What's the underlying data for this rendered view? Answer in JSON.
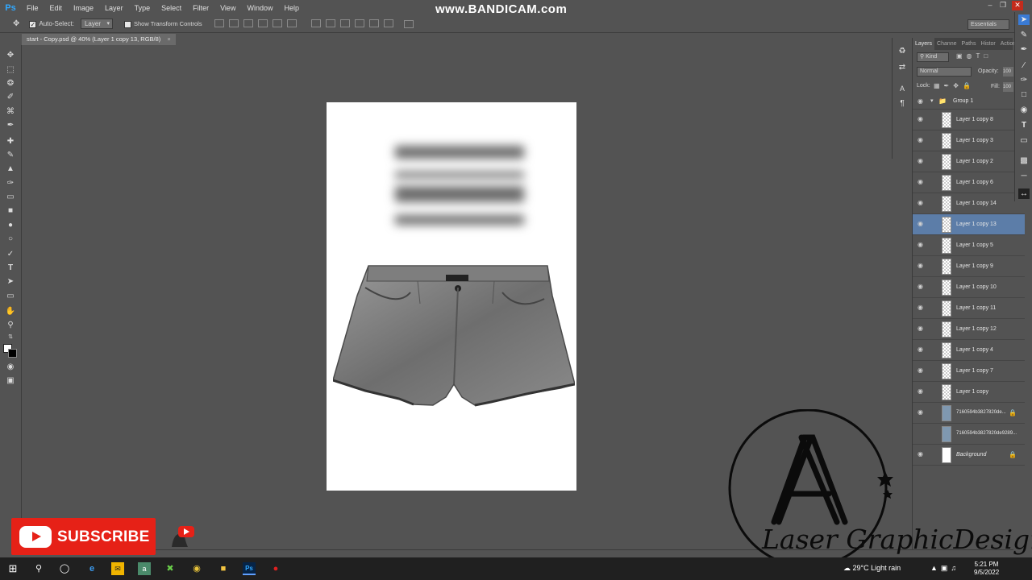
{
  "app": {
    "logo": "Ps",
    "menu": [
      "File",
      "Edit",
      "Image",
      "Layer",
      "Type",
      "Select",
      "Filter",
      "View",
      "Window",
      "Help"
    ],
    "watermark": "www.BANDICAM.com"
  },
  "options_bar": {
    "auto_select_label": "Auto-Select:",
    "auto_select_value": "Layer",
    "transform_label": "Show Transform Controls",
    "workspace": "Essentials"
  },
  "document": {
    "tab_title": "start - Copy.psd @ 40% (Layer 1 copy 13, RGB/8)"
  },
  "layers_panel": {
    "tabs": [
      "Layers",
      "Channe",
      "Paths",
      "Histor",
      "Action"
    ],
    "filter_kind": "Kind",
    "blend_mode": "Normal",
    "opacity_label": "Opacity:",
    "opacity_value": "100",
    "lock_label": "Lock:",
    "fill_label": "Fill:",
    "fill_value": "100",
    "group_name": "Group 1",
    "layers": [
      {
        "name": "Layer 1 copy 8",
        "selected": false
      },
      {
        "name": "Layer 1 copy 3",
        "selected": false
      },
      {
        "name": "Layer 1 copy 2",
        "selected": false
      },
      {
        "name": "Layer 1 copy 6",
        "selected": false
      },
      {
        "name": "Layer 1 copy 14",
        "selected": false
      },
      {
        "name": "Layer 1 copy 13",
        "selected": true
      },
      {
        "name": "Layer 1 copy 5",
        "selected": false
      },
      {
        "name": "Layer 1 copy 9",
        "selected": false
      },
      {
        "name": "Layer 1 copy 10",
        "selected": false
      },
      {
        "name": "Layer 1 copy 11",
        "selected": false
      },
      {
        "name": "Layer 1 copy 12",
        "selected": false
      },
      {
        "name": "Layer 1 copy 4",
        "selected": false
      },
      {
        "name": "Layer 1 copy 7",
        "selected": false
      },
      {
        "name": "Layer 1 copy",
        "selected": false
      }
    ],
    "image_layers": [
      {
        "name": "7160594b3827820de...",
        "locked": true,
        "visible": true
      },
      {
        "name": "7160594b3827820de9289...",
        "locked": false,
        "visible": false
      }
    ],
    "background_layer": "Background"
  },
  "overlay": {
    "subscribe_label": "SUBSCRIBE",
    "brand_text": "Laser GraphicDesigner",
    "brand_monogram": "A"
  },
  "taskbar": {
    "weather": "29°C  Light rain",
    "time": "5:21 PM",
    "date": "9/5/2022"
  },
  "colors": {
    "ui_bg": "#535353",
    "selection": "#5c7da8",
    "subscribe_red": "#e62117",
    "ps_blue": "#31a8ff"
  }
}
